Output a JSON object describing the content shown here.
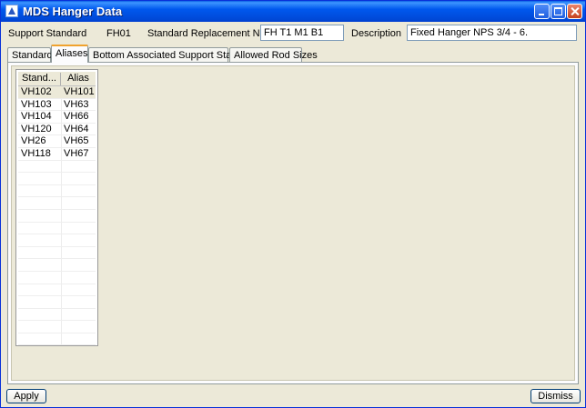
{
  "window": {
    "title": "MDS Hanger Data"
  },
  "header": {
    "support_standard_label": "Support Standard",
    "support_standard_value": "FH01",
    "replacement_label": "Standard Replacement Name",
    "replacement_value": "FH T1  M1 B1",
    "description_label": "Description",
    "description_value": "Fixed Hanger NPS 3/4 - 6."
  },
  "tabs": [
    {
      "label": "Standard"
    },
    {
      "label": "Aliases"
    },
    {
      "label": "Bottom Associated Support Standards"
    },
    {
      "label": "Allowed Rod Sizes"
    }
  ],
  "active_tab": "Aliases",
  "table": {
    "headers": [
      "Stand...",
      "Alias"
    ],
    "rows": [
      [
        "VH102",
        "VH101"
      ],
      [
        "VH103",
        "VH63"
      ],
      [
        "VH104",
        "VH66"
      ],
      [
        "VH120",
        "VH64"
      ],
      [
        "VH26",
        "VH65"
      ],
      [
        "VH118",
        "VH67"
      ],
      [
        "",
        ""
      ],
      [
        "",
        ""
      ],
      [
        "",
        ""
      ],
      [
        "",
        ""
      ],
      [
        "",
        ""
      ],
      [
        "",
        ""
      ],
      [
        "",
        ""
      ],
      [
        "",
        ""
      ],
      [
        "",
        ""
      ],
      [
        "",
        ""
      ],
      [
        "",
        ""
      ],
      [
        "",
        ""
      ],
      [
        "",
        ""
      ],
      [
        "",
        ""
      ],
      [
        "",
        ""
      ],
      [
        "",
        ""
      ]
    ]
  },
  "buttons": {
    "apply": "Apply",
    "dismiss": "Dismiss"
  }
}
